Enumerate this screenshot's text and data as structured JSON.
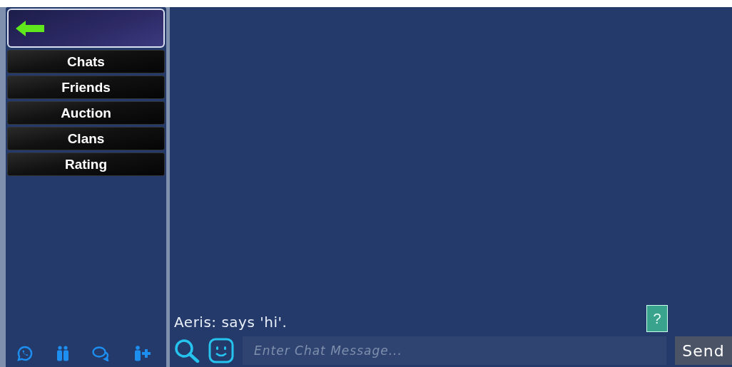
{
  "sidebar": {
    "menu": [
      {
        "label": "Chats"
      },
      {
        "label": "Friends"
      },
      {
        "label": "Auction"
      },
      {
        "label": "Clans"
      },
      {
        "label": "Rating"
      }
    ]
  },
  "chat": {
    "messages": [
      {
        "text": "Aeris: says 'hi'."
      }
    ],
    "help_button": "?",
    "input": {
      "placeholder": "Enter Chat Message..."
    },
    "send_button": "Send"
  }
}
